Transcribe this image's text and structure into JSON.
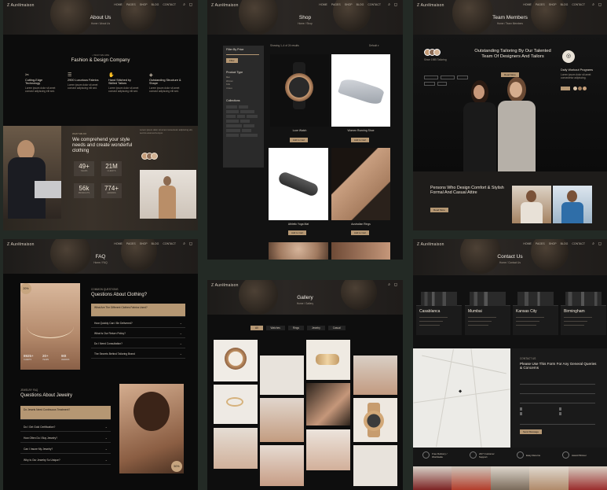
{
  "colors": {
    "bg": "#232a25",
    "panel": "#0f0f0f",
    "accent": "#b59773",
    "text": "#e9e2d8"
  },
  "about": {
    "logo": "Z Aurélmaison",
    "title": "About Us",
    "crumb": "Home / About Us",
    "subtitle": "Fashion & Design Company",
    "features": [
      {
        "label": "Cutting-Edge Technology"
      },
      {
        "label": "2900 Luxurious Fabrics"
      },
      {
        "label": "Hand Stitched by Skilled Tailors"
      },
      {
        "label": "Outstanding Structure & Shape"
      }
    ],
    "hero_text": "We comprehend your style needs and create wonderful clothing",
    "stats": [
      {
        "value": "49+",
        "label": "YEARS"
      },
      {
        "value": "21M",
        "label": "CLIENTS"
      },
      {
        "value": "56k",
        "label": "PRODUCTS"
      },
      {
        "value": "774+",
        "label": "AWARDS"
      }
    ]
  },
  "shop": {
    "title": "Shop",
    "crumb": "Home / Shop",
    "filter_title": "Filter By Price",
    "filter_btn": "Filter",
    "product_type": "Product Type",
    "collections": "Collections",
    "products": [
      {
        "name": "Luxe Watch"
      },
      {
        "name": "Women Running Shoe"
      },
      {
        "name": "Athletic Yoga Mat"
      },
      {
        "name": "Australian Rings"
      }
    ]
  },
  "team": {
    "title": "Team Members",
    "crumb": "Home / Team Members",
    "headline": "Outstanding Tailoring By Our Talented Team Of Designers And Tailors",
    "side_title": "Daily Workout Programs",
    "bottom_headline": "Persons Who Design Comfort & Stylish Formal And Casual Attire",
    "btn": "Read More"
  },
  "faq": {
    "title": "FAQ",
    "crumb": "Home / FAQ",
    "badge": "20%",
    "heading": "Questions About Clothing?",
    "clothing_q": [
      "What Are The Different Clothes Fabrics Used?",
      "How Quickly Can I Be Delivered?",
      "What Is Our Return Policy?",
      "Do I Need Consultation?",
      "The Secrets Behind Tailoring Brand"
    ],
    "stats": [
      {
        "value": "8925+",
        "label": "CLIENTS"
      },
      {
        "value": "20+",
        "label": "YEARS"
      },
      {
        "value": "90t",
        "label": "AWARDS"
      }
    ],
    "heading2": "Questions About Jewelry",
    "jewelry_q": [
      "Do Jewels Need Continuous Treatment?",
      "Do I Get Gold Certification?",
      "How Often Do I Buy Jewelry?",
      "Can I Insure My Jewelry?",
      "Why Is Our Jewelry So Unique?"
    ],
    "badge2": "50%"
  },
  "gallery": {
    "title": "Gallery",
    "crumb": "Home / Gallery",
    "tabs": [
      "All",
      "Watches",
      "Rings",
      "Jewelry",
      "Casual"
    ]
  },
  "contact": {
    "title": "Contact Us",
    "crumb": "Home / Contact Us",
    "cities": [
      "Casablanca",
      "Mumbai",
      "Kansas City",
      "Birmingham"
    ],
    "form_title": "Please Use This Form For Any General Queries & Concerns",
    "send": "Send Message",
    "services": [
      {
        "label": "Free Delivery / Worldwide"
      },
      {
        "label": "24/7 Customer Support"
      },
      {
        "label": "Easy Returns"
      },
      {
        "label": "Award Winner"
      }
    ]
  }
}
